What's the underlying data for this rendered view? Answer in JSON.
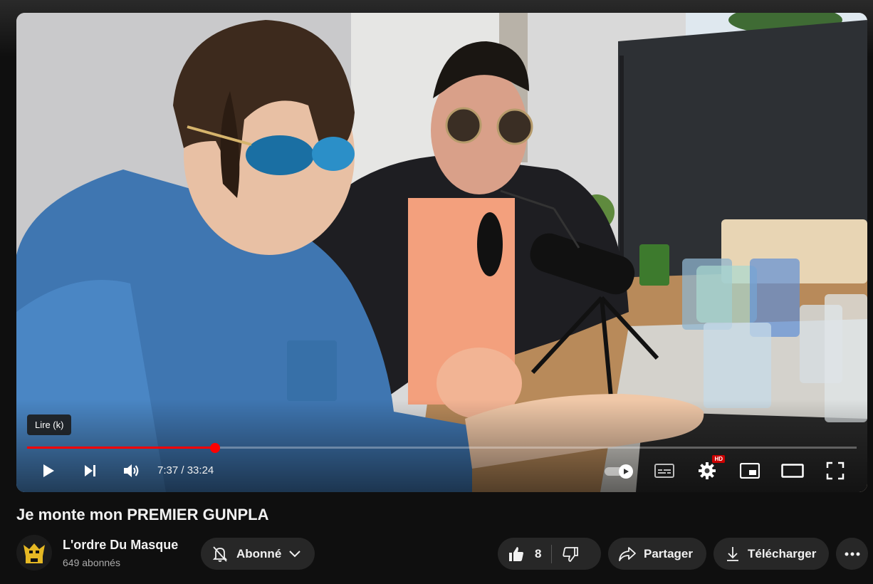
{
  "video": {
    "tooltip": "Lire (k)",
    "progress_fraction": 0.2266,
    "time_current": "7:37",
    "time_separator": " / ",
    "time_total": "33:24",
    "hd_badge": "HD"
  },
  "title": "Je monte mon PREMIER GUNPLA",
  "channel": {
    "name": "L'ordre Du Masque",
    "subscribers": "649 abonnés"
  },
  "actions": {
    "subscribe_label": "Abonné",
    "like_count": "8",
    "share_label": "Partager",
    "download_label": "Télécharger"
  },
  "colors": {
    "progress": "#ff0000",
    "pill_bg": "#272727",
    "background": "#0f0f0f"
  },
  "icons": [
    "play-icon",
    "next-icon",
    "volume-icon",
    "captions-icon",
    "settings-icon",
    "miniplayer-icon",
    "theater-icon",
    "fullscreen-icon",
    "bell-off-icon",
    "chevron-down-icon",
    "thumbs-up-icon",
    "thumbs-down-icon",
    "share-icon",
    "download-icon",
    "more-icon"
  ]
}
